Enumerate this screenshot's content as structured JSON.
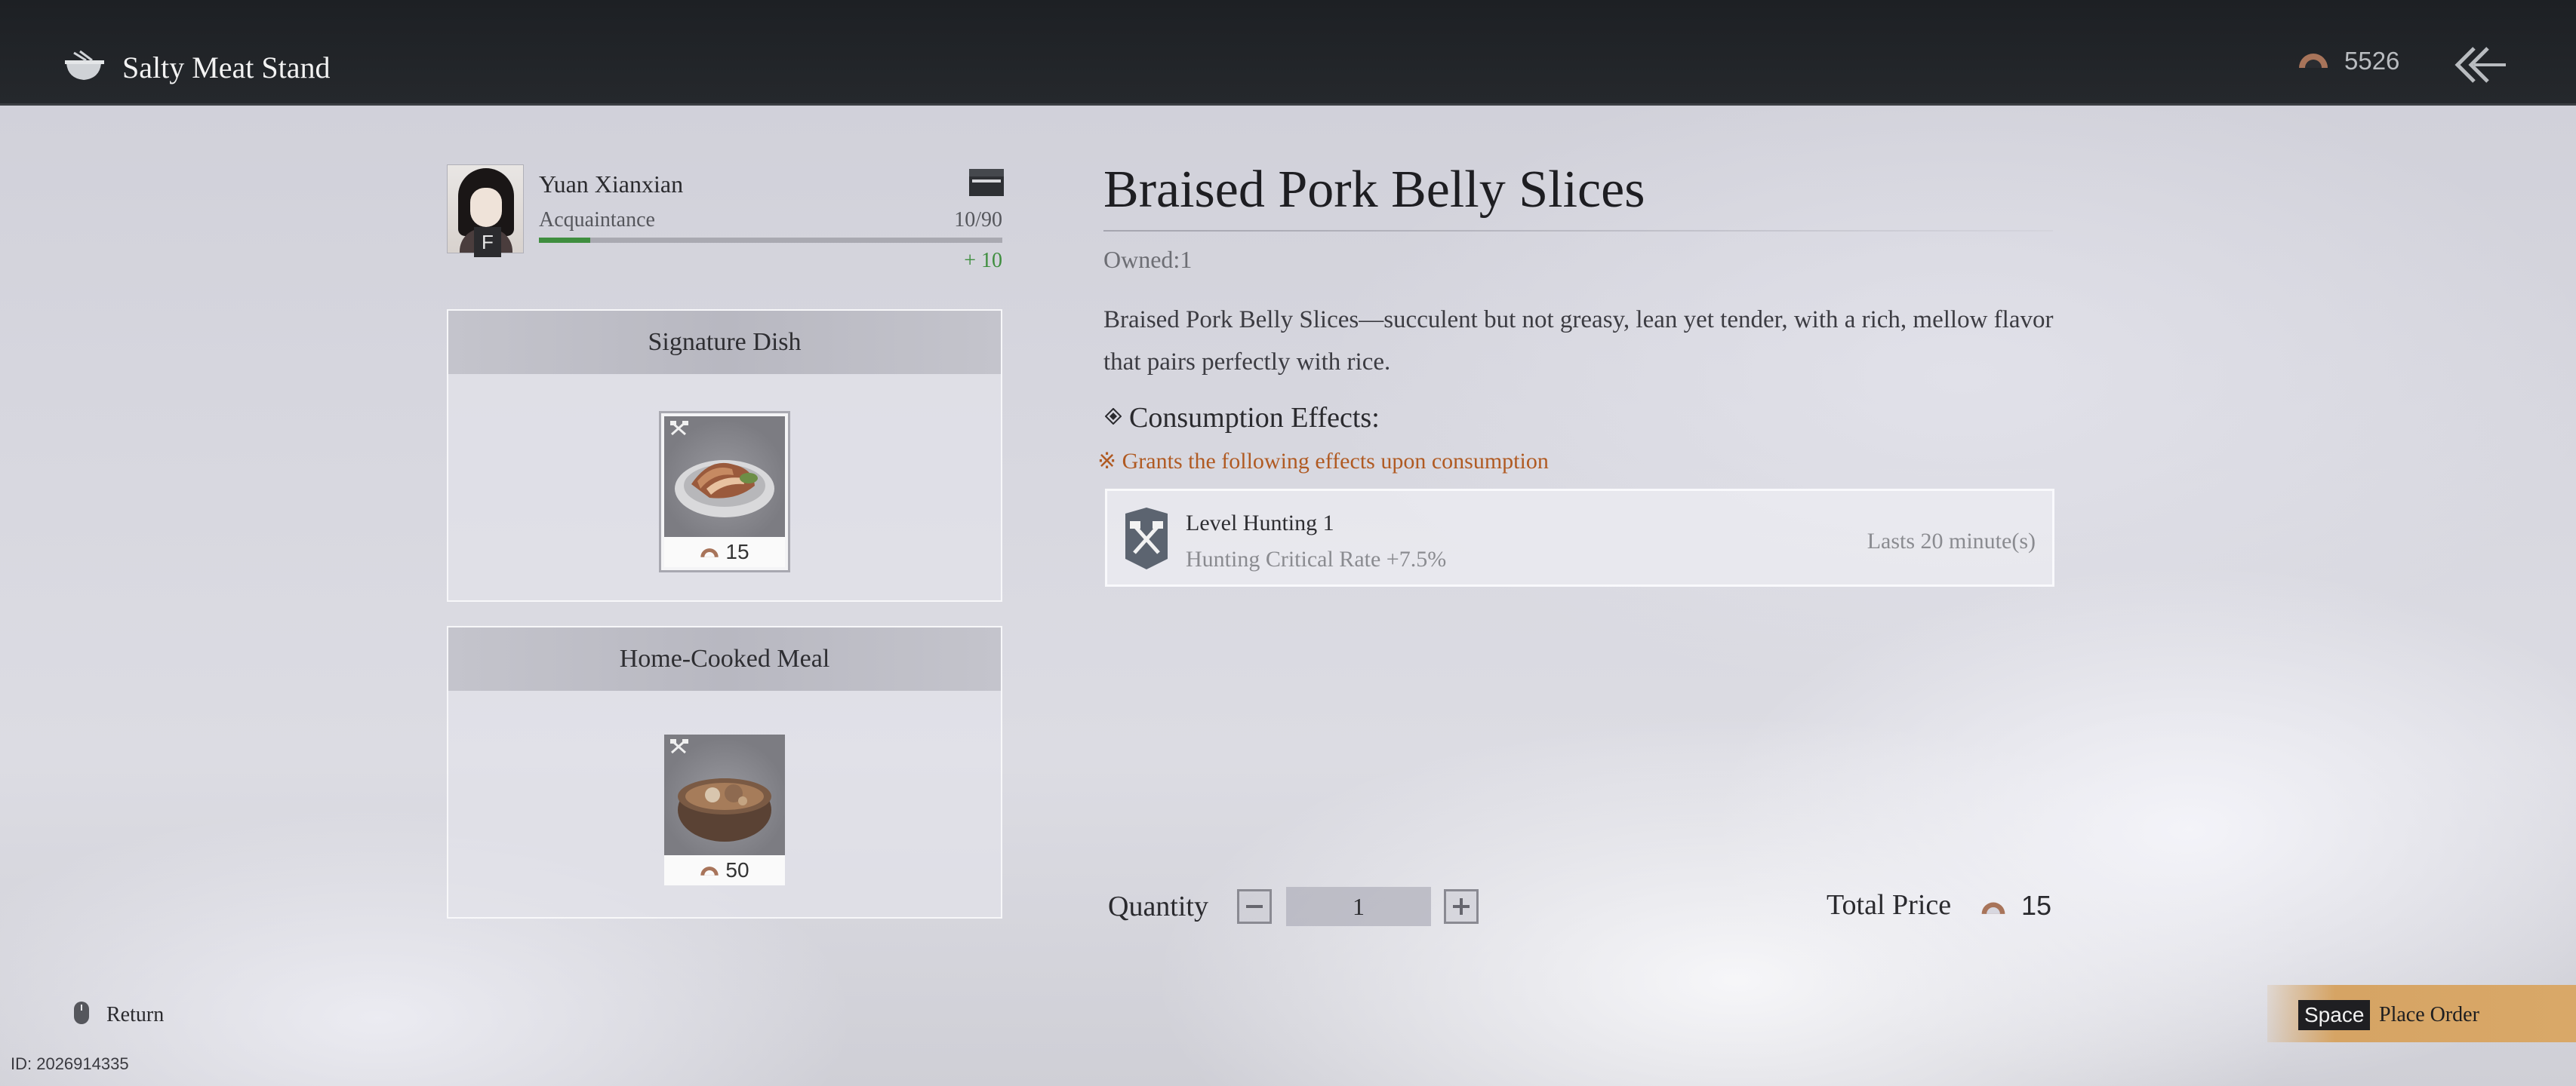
{
  "header": {
    "title": "Salty Meat Stand",
    "title_icon": "bowl-icon",
    "currency": "5526",
    "currency_icon": "coin-icon",
    "back_icon": "back-arrow-icon"
  },
  "relationship": {
    "name": "Yuan Xianxian",
    "status": "Acquaintance",
    "rank": "F",
    "favor": "10/90",
    "favor_fraction": 0.111,
    "favor_gain": "+ 10",
    "favor_color": "#3f8e3f",
    "gift_icon": "gift-icon"
  },
  "panels": [
    {
      "title": "Signature Dish",
      "items": [
        {
          "name": "Braised Pork Belly Slices",
          "price": "15",
          "selected": true
        }
      ]
    },
    {
      "title": "Home-Cooked Meal",
      "items": [
        {
          "name": "Stew Pot",
          "price": "50",
          "selected": false
        }
      ]
    }
  ],
  "detail": {
    "title": "Braised Pork Belly Slices",
    "owned": "Owned:1",
    "description": "Braised Pork Belly Slices—succulent but not greasy, lean yet tender, with a rich, mellow flavor that pairs perfectly with rice.",
    "effects_heading": "Consumption Effects:",
    "effects_note": "※ Grants the following effects upon consumption",
    "effect": {
      "name": "Level Hunting 1",
      "desc": "Hunting Critical Rate +7.5%",
      "duration": "Lasts 20 minute(s)",
      "icon": "hunting-axes-icon"
    }
  },
  "purchase": {
    "quantity_label": "Quantity",
    "quantity": "1",
    "total_label": "Total Price",
    "total": "15"
  },
  "footer": {
    "return_label": "Return",
    "order_key": "Space",
    "order_label": "Place Order",
    "player_id": "ID: 2026914335"
  },
  "colors": {
    "accent_orange": "#b05a22",
    "order_bar": "#d6a464",
    "topbar": "#1d2024"
  }
}
